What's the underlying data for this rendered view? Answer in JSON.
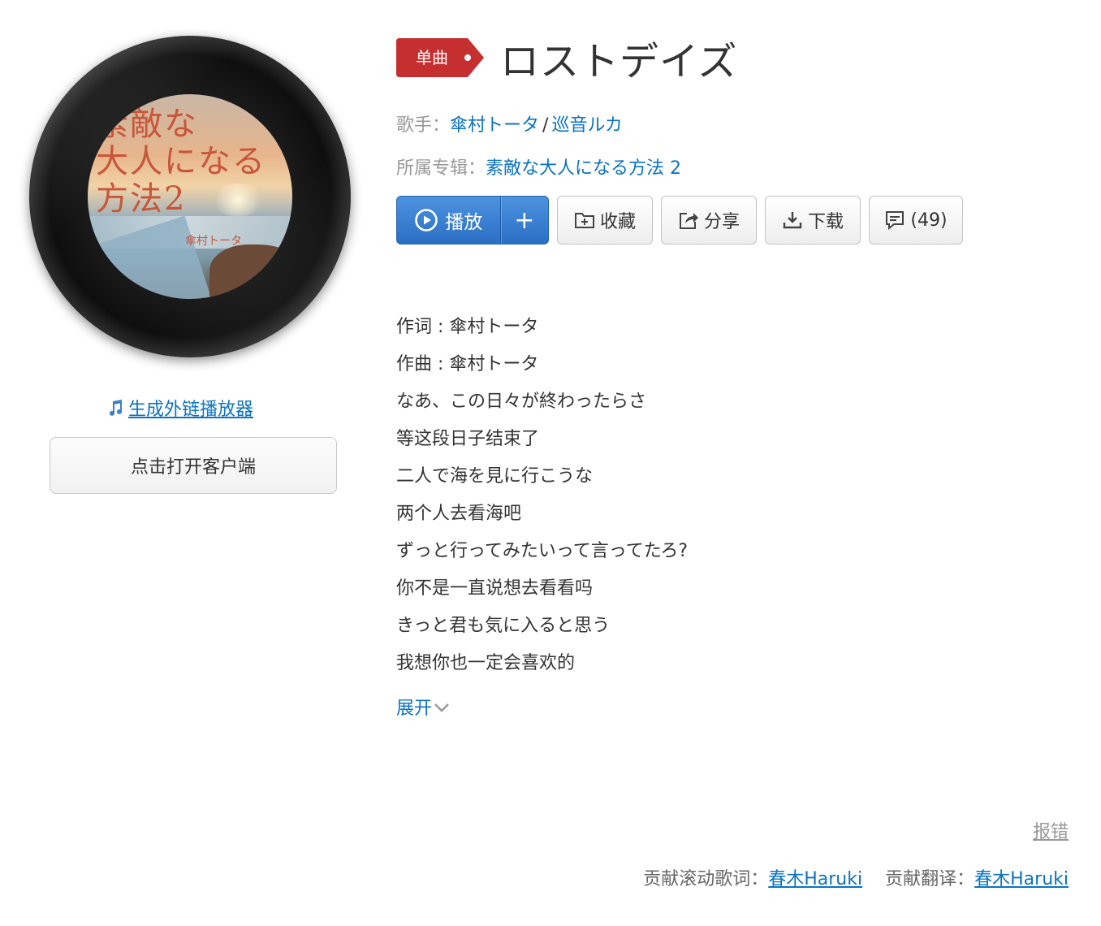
{
  "cover": {
    "art_title_lines": [
      "素敵な",
      "大人になる",
      "方法2"
    ],
    "art_signature": "傘村トータ",
    "vinyl_color": "#111111"
  },
  "left": {
    "ext_player_link": "生成外链播放器",
    "open_client_button": "点击打开客户端"
  },
  "song": {
    "tag_label": "单曲",
    "tag_color": "#c62f2f",
    "title": "ロストデイズ"
  },
  "meta": {
    "artist_label": "歌手：",
    "artists": [
      "傘村トータ",
      "巡音ルカ"
    ],
    "artist_separator": "/",
    "album_label": "所属专辑：",
    "album": "素敵な大人になる方法 2"
  },
  "actions": {
    "play": "播放",
    "add": "+",
    "collect": "收藏",
    "share": "分享",
    "download": "下载",
    "comments": "(49)"
  },
  "lyrics": {
    "lines": [
      "作词 : 傘村トータ",
      "作曲 : 傘村トータ",
      "なあ、この日々が終わったらさ",
      "等这段日子结束了",
      "二人で海を見に行こうな",
      "两个人去看海吧",
      "ずっと行ってみたいって言ってたろ?",
      "你不是一直说想去看看吗",
      "きっと君も気に入ると思う",
      "我想你也一定会喜欢的"
    ],
    "expand": "展开"
  },
  "footer": {
    "report": "报错",
    "scroll_lyrics_label": "贡献滚动歌词：",
    "scroll_lyrics_user": "春木Haruki",
    "translation_label": "贡献翻译：",
    "translation_user": "春木Haruki"
  },
  "colors": {
    "link": "#0c73c2",
    "play_button": "#2f78cc"
  }
}
